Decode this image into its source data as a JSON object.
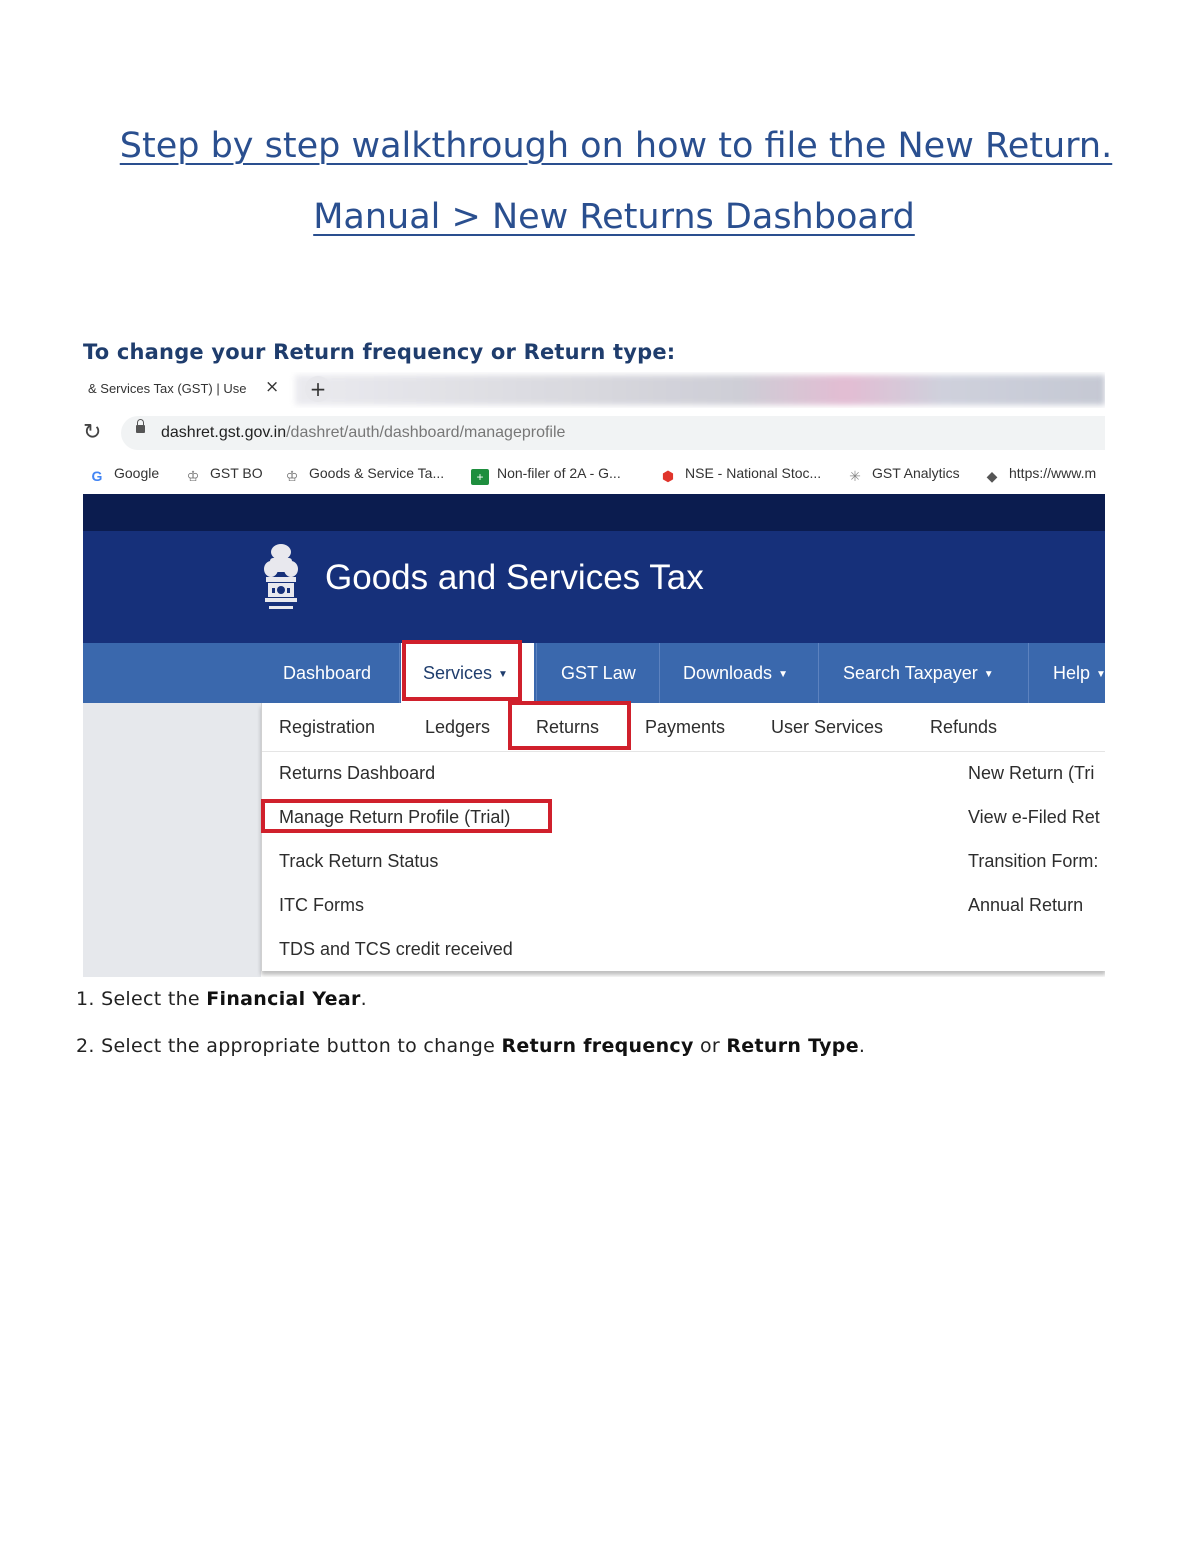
{
  "doc": {
    "title_line1": "Step by step walkthrough on how to file the New Return.",
    "title_line2": "Manual > New Returns Dashboard",
    "heading": "To change your Return frequency or Return type:"
  },
  "browser": {
    "tab_title": "& Services Tax (GST) | Use",
    "tab_close": "×",
    "new_tab": "+",
    "url_host": "dashret.gst.gov.in",
    "url_path": "/dashret/auth/dashboard/manageprofile",
    "bookmarks": [
      {
        "label": "Google",
        "icon": "google-icon"
      },
      {
        "label": "GST BO",
        "icon": "emblem-icon"
      },
      {
        "label": "Goods & Service Ta...",
        "icon": "emblem-icon"
      },
      {
        "label": "Non-filer of 2A - G...",
        "icon": "sheets-icon"
      },
      {
        "label": "NSE - National Stoc...",
        "icon": "nse-icon"
      },
      {
        "label": "GST Analytics",
        "icon": "analytics-icon"
      },
      {
        "label": "https://www.m",
        "icon": "link-icon"
      }
    ]
  },
  "gst": {
    "title": "Goods and Services Tax",
    "nav": {
      "dashboard": "Dashboard",
      "services": "Services",
      "gst_law": "GST Law",
      "downloads": "Downloads",
      "search_taxpayer": "Search Taxpayer",
      "help": "Help"
    },
    "subnav": {
      "registration": "Registration",
      "ledgers": "Ledgers",
      "returns": "Returns",
      "payments": "Payments",
      "user_services": "User Services",
      "refunds": "Refunds"
    },
    "menu_left": [
      "Returns Dashboard",
      "Manage Return Profile (Trial)",
      "Track Return Status",
      "ITC Forms",
      "TDS and TCS credit received"
    ],
    "menu_right": [
      "New Return (Tri",
      "View e-Filed Ret",
      "Transition Form:",
      "Annual Return"
    ],
    "highlight_color": "#d0202c"
  },
  "steps": [
    {
      "num": "1.",
      "pre": "Select the ",
      "bold": "Financial Year",
      "post": ".",
      "bold2_pre": "",
      "bold2": "",
      "end": ""
    },
    {
      "num": "2.",
      "pre": "Select the appropriate button to change ",
      "bold": "Return frequency",
      "post": " or ",
      "bold2": "Return Type",
      "end": "."
    }
  ]
}
